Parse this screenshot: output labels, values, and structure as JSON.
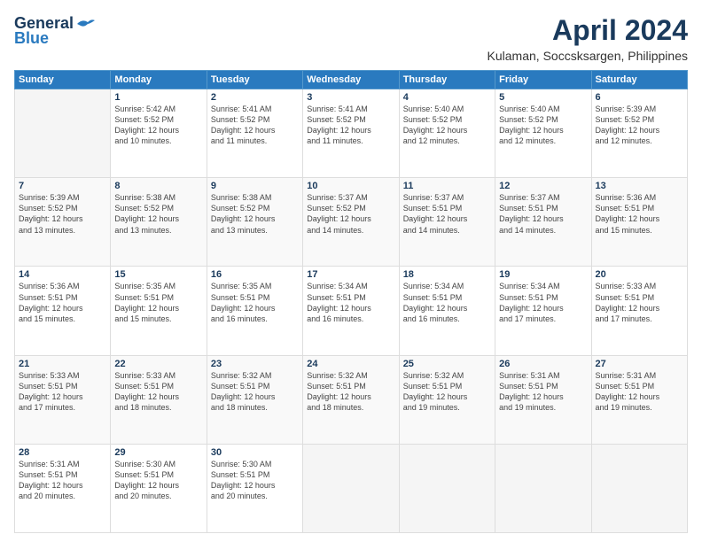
{
  "header": {
    "logo_line1": "General",
    "logo_line2": "Blue",
    "main_title": "April 2024",
    "subtitle": "Kulaman, Soccsksargen, Philippines"
  },
  "days_of_week": [
    "Sunday",
    "Monday",
    "Tuesday",
    "Wednesday",
    "Thursday",
    "Friday",
    "Saturday"
  ],
  "weeks": [
    [
      {
        "day": "",
        "info": ""
      },
      {
        "day": "1",
        "info": "Sunrise: 5:42 AM\nSunset: 5:52 PM\nDaylight: 12 hours\nand 10 minutes."
      },
      {
        "day": "2",
        "info": "Sunrise: 5:41 AM\nSunset: 5:52 PM\nDaylight: 12 hours\nand 11 minutes."
      },
      {
        "day": "3",
        "info": "Sunrise: 5:41 AM\nSunset: 5:52 PM\nDaylight: 12 hours\nand 11 minutes."
      },
      {
        "day": "4",
        "info": "Sunrise: 5:40 AM\nSunset: 5:52 PM\nDaylight: 12 hours\nand 12 minutes."
      },
      {
        "day": "5",
        "info": "Sunrise: 5:40 AM\nSunset: 5:52 PM\nDaylight: 12 hours\nand 12 minutes."
      },
      {
        "day": "6",
        "info": "Sunrise: 5:39 AM\nSunset: 5:52 PM\nDaylight: 12 hours\nand 12 minutes."
      }
    ],
    [
      {
        "day": "7",
        "info": "Sunrise: 5:39 AM\nSunset: 5:52 PM\nDaylight: 12 hours\nand 13 minutes."
      },
      {
        "day": "8",
        "info": "Sunrise: 5:38 AM\nSunset: 5:52 PM\nDaylight: 12 hours\nand 13 minutes."
      },
      {
        "day": "9",
        "info": "Sunrise: 5:38 AM\nSunset: 5:52 PM\nDaylight: 12 hours\nand 13 minutes."
      },
      {
        "day": "10",
        "info": "Sunrise: 5:37 AM\nSunset: 5:52 PM\nDaylight: 12 hours\nand 14 minutes."
      },
      {
        "day": "11",
        "info": "Sunrise: 5:37 AM\nSunset: 5:51 PM\nDaylight: 12 hours\nand 14 minutes."
      },
      {
        "day": "12",
        "info": "Sunrise: 5:37 AM\nSunset: 5:51 PM\nDaylight: 12 hours\nand 14 minutes."
      },
      {
        "day": "13",
        "info": "Sunrise: 5:36 AM\nSunset: 5:51 PM\nDaylight: 12 hours\nand 15 minutes."
      }
    ],
    [
      {
        "day": "14",
        "info": "Sunrise: 5:36 AM\nSunset: 5:51 PM\nDaylight: 12 hours\nand 15 minutes."
      },
      {
        "day": "15",
        "info": "Sunrise: 5:35 AM\nSunset: 5:51 PM\nDaylight: 12 hours\nand 15 minutes."
      },
      {
        "day": "16",
        "info": "Sunrise: 5:35 AM\nSunset: 5:51 PM\nDaylight: 12 hours\nand 16 minutes."
      },
      {
        "day": "17",
        "info": "Sunrise: 5:34 AM\nSunset: 5:51 PM\nDaylight: 12 hours\nand 16 minutes."
      },
      {
        "day": "18",
        "info": "Sunrise: 5:34 AM\nSunset: 5:51 PM\nDaylight: 12 hours\nand 16 minutes."
      },
      {
        "day": "19",
        "info": "Sunrise: 5:34 AM\nSunset: 5:51 PM\nDaylight: 12 hours\nand 17 minutes."
      },
      {
        "day": "20",
        "info": "Sunrise: 5:33 AM\nSunset: 5:51 PM\nDaylight: 12 hours\nand 17 minutes."
      }
    ],
    [
      {
        "day": "21",
        "info": "Sunrise: 5:33 AM\nSunset: 5:51 PM\nDaylight: 12 hours\nand 17 minutes."
      },
      {
        "day": "22",
        "info": "Sunrise: 5:33 AM\nSunset: 5:51 PM\nDaylight: 12 hours\nand 18 minutes."
      },
      {
        "day": "23",
        "info": "Sunrise: 5:32 AM\nSunset: 5:51 PM\nDaylight: 12 hours\nand 18 minutes."
      },
      {
        "day": "24",
        "info": "Sunrise: 5:32 AM\nSunset: 5:51 PM\nDaylight: 12 hours\nand 18 minutes."
      },
      {
        "day": "25",
        "info": "Sunrise: 5:32 AM\nSunset: 5:51 PM\nDaylight: 12 hours\nand 19 minutes."
      },
      {
        "day": "26",
        "info": "Sunrise: 5:31 AM\nSunset: 5:51 PM\nDaylight: 12 hours\nand 19 minutes."
      },
      {
        "day": "27",
        "info": "Sunrise: 5:31 AM\nSunset: 5:51 PM\nDaylight: 12 hours\nand 19 minutes."
      }
    ],
    [
      {
        "day": "28",
        "info": "Sunrise: 5:31 AM\nSunset: 5:51 PM\nDaylight: 12 hours\nand 20 minutes."
      },
      {
        "day": "29",
        "info": "Sunrise: 5:30 AM\nSunset: 5:51 PM\nDaylight: 12 hours\nand 20 minutes."
      },
      {
        "day": "30",
        "info": "Sunrise: 5:30 AM\nSunset: 5:51 PM\nDaylight: 12 hours\nand 20 minutes."
      },
      {
        "day": "",
        "info": ""
      },
      {
        "day": "",
        "info": ""
      },
      {
        "day": "",
        "info": ""
      },
      {
        "day": "",
        "info": ""
      }
    ]
  ]
}
